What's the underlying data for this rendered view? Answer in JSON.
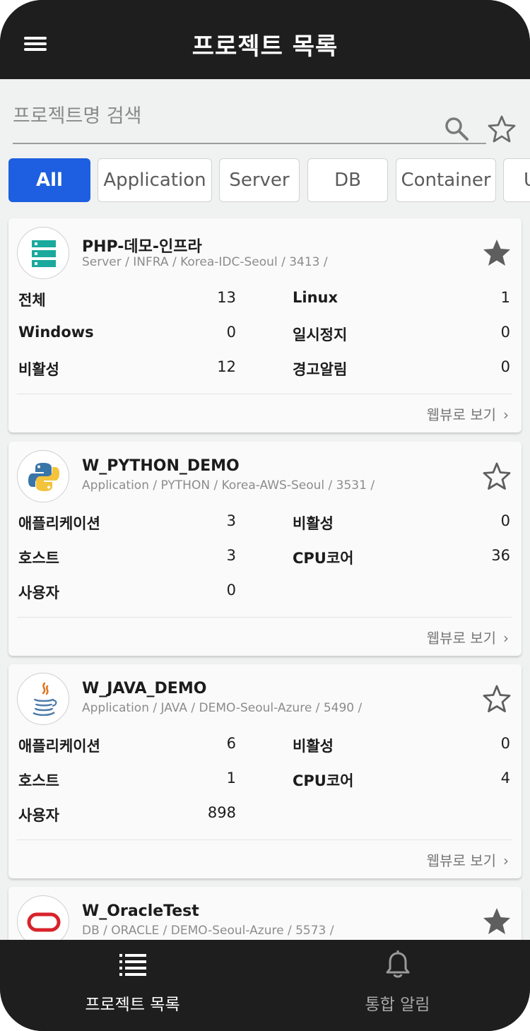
{
  "header": {
    "title": "프로젝트 목록"
  },
  "search": {
    "placeholder": "프로젝트명 검색"
  },
  "filters": [
    "All",
    "Application",
    "Server",
    "DB",
    "Container",
    "U"
  ],
  "cards": [
    {
      "title": "PHP-데모-인프라",
      "subtitle": "Server / INFRA / Korea-IDC-Seoul / 3413 /",
      "logo": "server-icon",
      "favorite": true,
      "stats": [
        {
          "label": "전체",
          "value": "13"
        },
        {
          "label": "Linux",
          "value": "1"
        },
        {
          "label": "Windows",
          "value": "0"
        },
        {
          "label": "일시정지",
          "value": "0"
        },
        {
          "label": "비활성",
          "value": "12"
        },
        {
          "label": "경고알림",
          "value": "0"
        }
      ],
      "link": "웹뷰로 보기"
    },
    {
      "title": "W_PYTHON_DEMO",
      "subtitle": "Application / PYTHON / Korea-AWS-Seoul / 3531 /",
      "logo": "python-icon",
      "favorite": false,
      "stats": [
        {
          "label": "애플리케이션",
          "value": "3"
        },
        {
          "label": "비활성",
          "value": "0"
        },
        {
          "label": "호스트",
          "value": "3"
        },
        {
          "label": "CPU코어",
          "value": "36"
        },
        {
          "label": "사용자",
          "value": "0"
        }
      ],
      "link": "웹뷰로 보기"
    },
    {
      "title": "W_JAVA_DEMO",
      "subtitle": "Application / JAVA / DEMO-Seoul-Azure / 5490 /",
      "logo": "java-icon",
      "favorite": false,
      "stats": [
        {
          "label": "애플리케이션",
          "value": "6"
        },
        {
          "label": "비활성",
          "value": "0"
        },
        {
          "label": "호스트",
          "value": "1"
        },
        {
          "label": "CPU코어",
          "value": "4"
        },
        {
          "label": "사용자",
          "value": "898"
        }
      ],
      "link": "웹뷰로 보기"
    },
    {
      "title": "W_OracleTest",
      "subtitle": "DB / ORACLE / DEMO-Seoul-Azure / 5573 /",
      "logo": "oracle-icon",
      "favorite": true
    }
  ],
  "tabbar": {
    "projects_label": "프로젝트 목록",
    "alerts_label": "통합 알림"
  },
  "colors": {
    "accent": "#1d5fe0",
    "header_bg": "#1e1e1e",
    "content_bg": "#f0f1f1",
    "server_teal": "#1aa99c"
  }
}
